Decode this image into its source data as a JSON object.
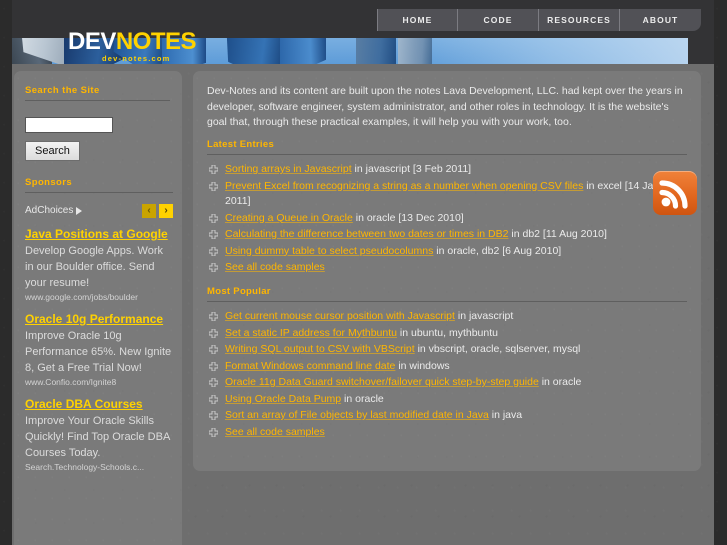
{
  "site": {
    "logo_primary": "DEV",
    "logo_secondary": "NOTES",
    "logo_subtitle": "dev-notes.com"
  },
  "nav": {
    "items": [
      {
        "label": "HOME"
      },
      {
        "label": "CODE"
      },
      {
        "label": "RESOURCES"
      },
      {
        "label": "ABOUT"
      }
    ]
  },
  "sidebar": {
    "search": {
      "title": "Search the Site",
      "value": "",
      "placeholder": "",
      "button_label": "Search"
    },
    "sponsors": {
      "title": "Sponsors",
      "adchoices_label": "AdChoices",
      "prev_label": "‹",
      "next_label": "›",
      "ads": [
        {
          "title": "Java Positions at Google",
          "description": "Develop Google Apps. Work in our Boulder office. Send your resume!",
          "url": "www.google.com/jobs/boulder"
        },
        {
          "title": "Oracle 10g Performance",
          "description": "Improve Oracle 10g Performance 65%. New Ignite 8, Get a Free Trial Now!",
          "url": "www.Confio.com/Ignite8"
        },
        {
          "title": "Oracle DBA Courses",
          "description": "Improve Your Oracle Skills Quickly! Find Top Oracle DBA Courses Today.",
          "url": "Search.Technology-Schools.c..."
        }
      ]
    }
  },
  "content": {
    "intro": "Dev-Notes and its content are built upon the notes Lava Development, LLC. had kept over the years in developer, software engineer, system administrator, and other roles in technology. It is the website's goal that, through these practical examples, it will help you with your work, too.",
    "latest": {
      "title": "Latest Entries",
      "entries": [
        {
          "link": "Sorting arrays in Javascript",
          "meta": " in javascript [3 Feb 2011]"
        },
        {
          "link": "Prevent Excel from recognizing a string as a number when opening CSV files",
          "meta": " in excel [14 Jan 2011]"
        },
        {
          "link": "Creating a Queue in Oracle",
          "meta": " in oracle [13 Dec 2010]"
        },
        {
          "link": "Calculating the difference between two dates or times in DB2",
          "meta": " in db2 [11 Aug 2010]"
        },
        {
          "link": "Using dummy table to select pseudocolumns",
          "meta": " in oracle, db2 [6 Aug 2010]"
        },
        {
          "link": "See all code samples",
          "meta": ""
        }
      ]
    },
    "popular": {
      "title": "Most Popular",
      "entries": [
        {
          "link": "Get current mouse cursor position with Javascript",
          "meta": " in javascript"
        },
        {
          "link": "Set a static IP address for Mythbuntu",
          "meta": " in ubuntu, mythbuntu"
        },
        {
          "link": "Writing SQL output to CSV with VBScript",
          "meta": " in vbscript, oracle, sqlserver, mysql"
        },
        {
          "link": "Format Windows command line date",
          "meta": " in windows"
        },
        {
          "link": "Oracle 11g Data Guard switchover/failover quick step-by-step guide",
          "meta": " in oracle"
        },
        {
          "link": "Using Oracle Data Pump",
          "meta": " in oracle"
        },
        {
          "link": "Sort an array of File objects by last modified date in Java",
          "meta": " in java"
        },
        {
          "link": "See all code samples",
          "meta": ""
        }
      ]
    },
    "rss": {
      "title": "RSS Feed"
    }
  },
  "colors": {
    "accent_orange": "#ffb600",
    "link_yellow": "#ffd200",
    "panel_gray": "#7a7a7a",
    "page_gray": "#6e6e6e",
    "topbar_dark": "#333335",
    "rss_orange": "#e2671f"
  }
}
